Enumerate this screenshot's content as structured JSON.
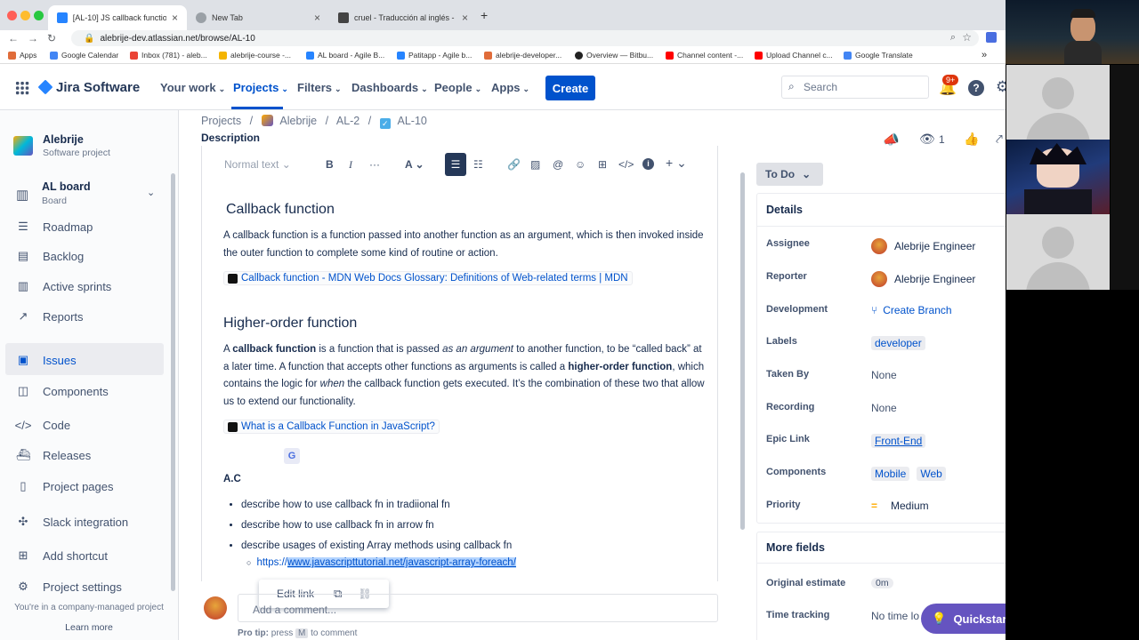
{
  "browser": {
    "tabs": [
      {
        "title": "[AL-10] JS callback functions",
        "active": true
      },
      {
        "title": "New Tab",
        "active": false
      },
      {
        "title": "cruel - Traducción al inglés -",
        "active": false
      }
    ],
    "new_tab": "+",
    "url": "alebrije-dev.atlassian.net/browse/AL-10",
    "bookmarks": [
      "Apps",
      "Google Calendar",
      "Inbox (781) - aleb...",
      "alebrije-course -...",
      "AL board - Agile B...",
      "Patitapp - Agile b...",
      "alebrije-developer...",
      "Overview — Bitbu...",
      "Channel content -...",
      "Upload Channel c...",
      "Google Translate"
    ],
    "bookmarks_more": "»"
  },
  "header": {
    "product": "Jira Software",
    "nav": [
      "Your work",
      "Projects",
      "Filters",
      "Dashboards",
      "People",
      "Apps"
    ],
    "create": "Create",
    "search_placeholder": "Search",
    "notif_badge": "9+"
  },
  "sidebar": {
    "project_name": "Alebrije",
    "project_type": "Software project",
    "board_name": "AL board",
    "board_sub": "Board",
    "items": [
      "Roadmap",
      "Backlog",
      "Active sprints",
      "Reports",
      "Issues",
      "Components",
      "Code",
      "Releases",
      "Project pages",
      "Slack integration",
      "Add shortcut",
      "Project settings"
    ],
    "footer": "You're in a company-managed project",
    "learn_more": "Learn more"
  },
  "breadcrumb": [
    "Projects",
    "Alebrije",
    "AL-2",
    "AL-10"
  ],
  "description_label": "Description",
  "toolbar": {
    "text_style": "Normal text"
  },
  "doc": {
    "h1": "Callback function",
    "p1": "A callback function is a function passed into another function as an argument, which is then invoked inside the outer function to complete some kind of routine or action.",
    "link1": "Callback function - MDN Web Docs Glossary: Definitions of Web-related terms | MDN",
    "h2": "Higher-order function",
    "p2_a": "A ",
    "p2_b": "callback function",
    "p2_c": " is a function that is passed ",
    "p2_d": "as an argument",
    "p2_e": " to another function, to be “called back” at a later time. A function that accepts other functions as arguments is called a ",
    "p2_f": "higher-order function",
    "p2_g": ", which contains the logic for ",
    "p2_h": "when",
    "p2_i": " the callback function gets executed. It’s the combination of these two that allow us to extend our functionality.",
    "link2": "What is a Callback Function in JavaScript?",
    "ac_label": "A.C",
    "bullets": [
      "describe how to use callback fn in tradiional fn",
      "describe how to use callback fn in arrow fn",
      "describe usages of existing Array methods using callback fn"
    ],
    "sub_prefix": "https://",
    "sub_link": "www.javascripttutorial.net/javascript-array-foreach/"
  },
  "link_popup": {
    "edit": "Edit link"
  },
  "comment": {
    "placeholder": "Add a comment...",
    "tip_a": "Pro tip:",
    "tip_b": "press",
    "tip_key": "M",
    "tip_c": "to comment"
  },
  "issue": {
    "watch_count": "1",
    "status": "To Do",
    "details_title": "Details",
    "fields": [
      {
        "label": "Assignee",
        "value": "Alebrije Engineer"
      },
      {
        "label": "Reporter",
        "value": "Alebrije Engineer"
      },
      {
        "label": "Development",
        "value": "Create Branch"
      },
      {
        "label": "Labels",
        "value": "developer"
      },
      {
        "label": "Taken By",
        "value": "None"
      },
      {
        "label": "Recording",
        "value": "None"
      },
      {
        "label": "Epic Link",
        "value": "Front-End"
      },
      {
        "label": "Components",
        "value": "Mobile"
      },
      {
        "label": "Priority",
        "value": "Medium"
      }
    ],
    "component_2": "Web",
    "more_fields": "More fields",
    "original_estimate_label": "Original estimate",
    "original_estimate": "0m",
    "time_tracking_label": "Time tracking",
    "time_tracking": "No time lo"
  },
  "quickstart": "Quickstart",
  "colors": {
    "accent": "#0052cc",
    "quickstart": "#6554c0",
    "status_bg": "#dfe1e6",
    "sidebar_active": "#ebecf0"
  }
}
